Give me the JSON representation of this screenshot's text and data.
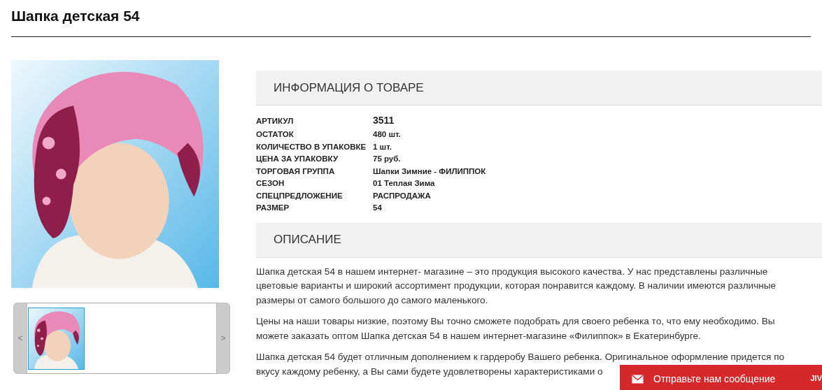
{
  "page_title": "Шапка детская 54",
  "gallery": {
    "prev": "<",
    "next": ">"
  },
  "info": {
    "heading": "ИНФОРМАЦИЯ О ТОВАРЕ",
    "rows": [
      {
        "label": "АРТИКУЛ",
        "value": "3511",
        "kind": "code"
      },
      {
        "label": "ОСТАТОК",
        "value": "480 шт.",
        "kind": "plain"
      },
      {
        "label": "КОЛИЧЕСТВО В УПАКОВКЕ",
        "value": "1 шт.",
        "kind": "plain"
      },
      {
        "label": "ЦЕНА ЗА УПАКОВКУ",
        "value": "75 руб.",
        "kind": "plain"
      },
      {
        "label": "ТОРГОВАЯ ГРУППА",
        "value": "Шапки Зимние - ФИЛИППОК",
        "kind": "plain"
      },
      {
        "label": "СЕЗОН",
        "value": "01 Теплая Зима",
        "kind": "plain"
      },
      {
        "label": "СПЕЦПРЕДЛОЖЕНИЕ",
        "value": "РАСПРОДАЖА",
        "kind": "plain"
      },
      {
        "label": "РАЗМЕР",
        "value": "54",
        "kind": "plain"
      }
    ]
  },
  "description": {
    "heading": "ОПИСАНИЕ",
    "paragraphs": [
      {
        "text": "Шапка детская 54 в нашем интернет- магазине – это продукция высокого качества. У нас представлены различные цветовые варианты и широкий ассортимент продукции, которая понравится каждому. В наличии имеются различные размеры от самого большого до самого маленького."
      },
      {
        "text": "Цены на наши товары низкие, поэтому Вы точно сможете подобрать для своего ребенка то, что ему необходимо. Вы можете заказать оптом Шапка детская 54 в нашем интернет-магазине «Филиппок» в Екатеринбурге."
      },
      {
        "lines": [
          "Шапка детская 54 будет отличным дополнением к гардеробу Вашего ребенка. Оригинальное оформление придется по",
          "вкусу каждому ребенку, а Вы сами будете удовлетворены характеристиками о"
        ]
      }
    ]
  },
  "chat": {
    "label": "Отправьте нам сообщение",
    "logo": "JIV"
  }
}
